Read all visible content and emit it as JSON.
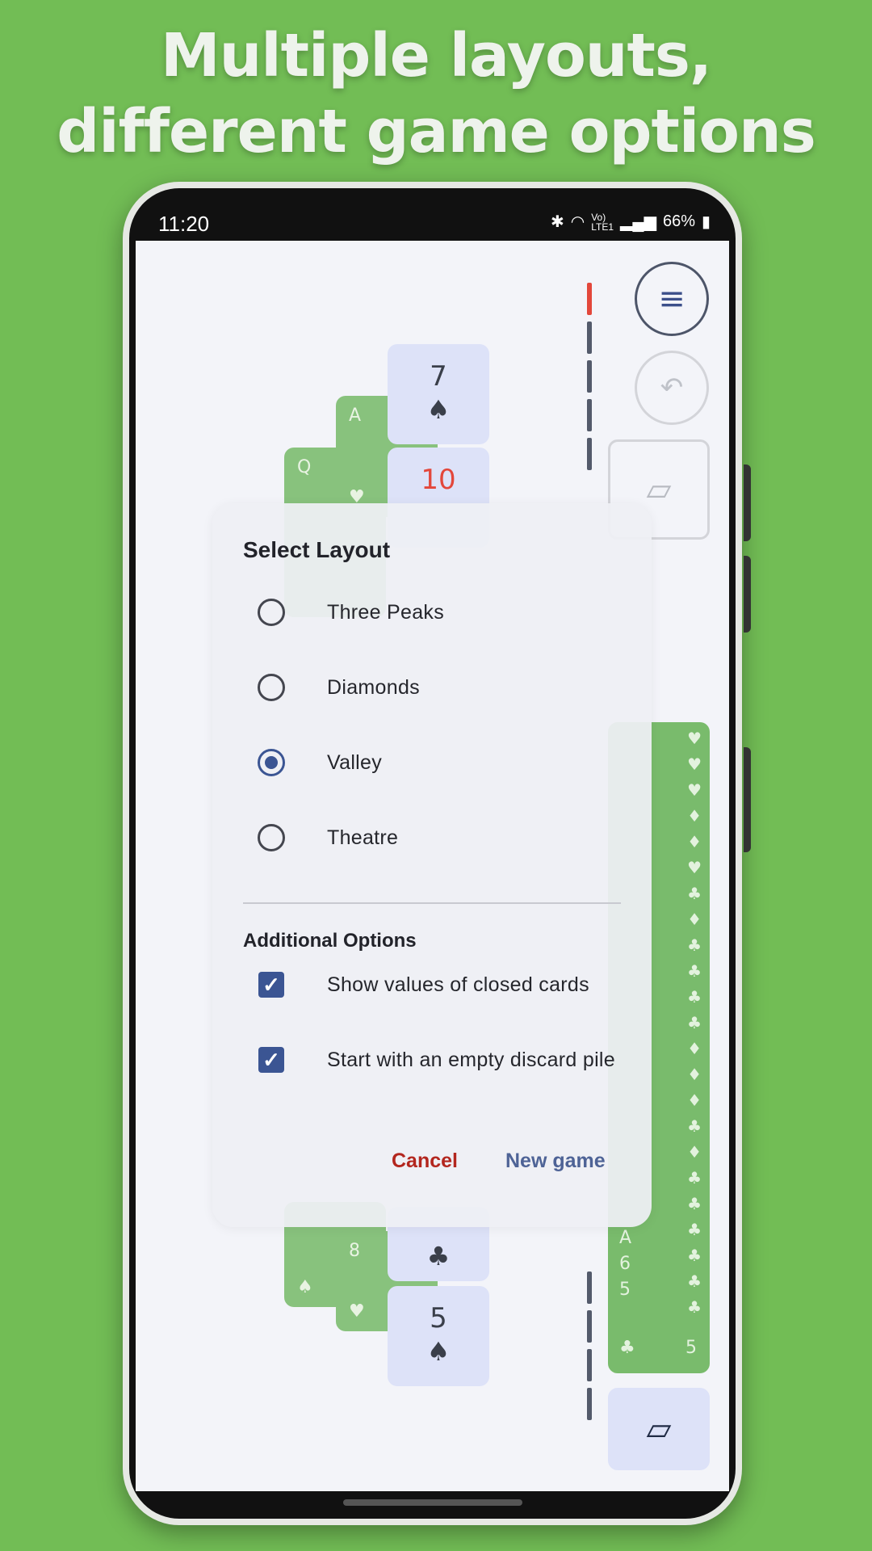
{
  "headline": {
    "line1": "Multiple layouts,",
    "line2": "different game options"
  },
  "status_bar": {
    "time": "11:20",
    "battery": "66%",
    "icons": [
      "bluetooth-icon",
      "wifi-icon",
      "volte-icon",
      "signal-icon",
      "battery-icon"
    ]
  },
  "game": {
    "top_cards": [
      {
        "rank": "7",
        "suit": "♠"
      },
      {
        "rank": "A",
        "suit": "♥"
      },
      {
        "rank": "Q",
        "suit": ""
      },
      {
        "rank": "10",
        "suit": ""
      }
    ],
    "bottom_cards": [
      {
        "rank": "8",
        "suit": "♥"
      },
      {
        "rank": "",
        "suit": "♠"
      },
      {
        "rank": "",
        "suit": "♣"
      },
      {
        "rank": "5",
        "suit": "♠"
      }
    ],
    "stock": {
      "suit_column": [
        "♥",
        "♥",
        "♥",
        "♦",
        "♦",
        "♥",
        "♣",
        "♦",
        "♣",
        "♣",
        "♣",
        "♣",
        "♦",
        "♦",
        "♦",
        "♣",
        "♦",
        "♣",
        "♣",
        "♣",
        "♣",
        "♣",
        "♣"
      ],
      "labels": [
        "A",
        "6",
        "5"
      ],
      "bottom_left": "♣",
      "bottom_right": "5"
    },
    "colors": {
      "background": "#72bd55",
      "card_front": "#dde2f8",
      "card_back": "#88c27d",
      "accent": "#3b5593",
      "cancel": "#b3261e",
      "divider_active": "#e3473b"
    }
  },
  "dialog": {
    "title": "Select Layout",
    "layouts": [
      {
        "label": "Three Peaks",
        "selected": false
      },
      {
        "label": "Diamonds",
        "selected": false
      },
      {
        "label": "Valley",
        "selected": true
      },
      {
        "label": "Theatre",
        "selected": false
      }
    ],
    "additional_title": "Additional Options",
    "options": [
      {
        "label": "Show values of closed cards",
        "checked": true
      },
      {
        "label": "Start with an empty discard pile",
        "checked": true
      }
    ],
    "cancel_label": "Cancel",
    "new_game_label": "New game"
  }
}
